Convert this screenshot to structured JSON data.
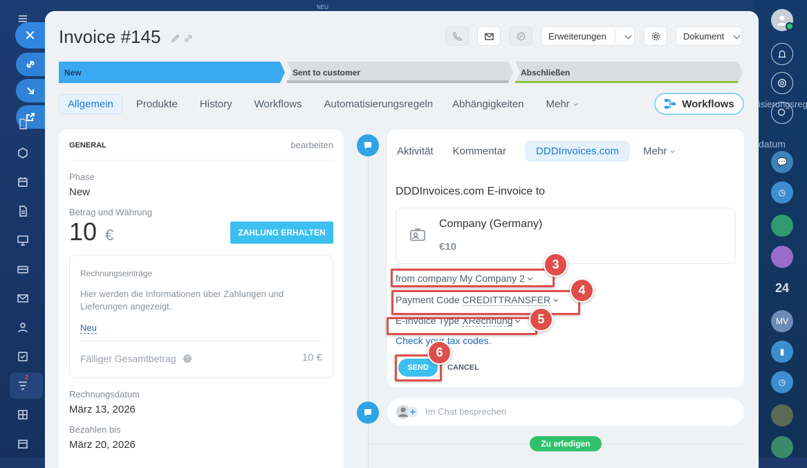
{
  "app": {
    "left_nav_icons": [
      "menu-icon",
      "chat-icon",
      "document-icon",
      "shield-icon",
      "calendar-icon",
      "file-icon",
      "presentation-icon",
      "card-icon",
      "mail-icon",
      "people-icon",
      "checklist-icon",
      "funnel-icon",
      "grid-icon",
      "archive-icon"
    ],
    "funnel_badge": "2",
    "top_badge": "NEU",
    "right_avatar_initials": "MV",
    "right_badge_24": "24",
    "right_partial_text": "isierungsrege",
    "right_partial_text_2": "datum"
  },
  "header": {
    "title": "Invoice #145",
    "erweiterungen_label": "Erweiterungen",
    "dokument_label": "Dokument"
  },
  "stages": [
    {
      "label": "New",
      "color": "#3ba9ef",
      "text_color": "#1b3f6b"
    },
    {
      "label": "Sent to customer",
      "color": "#d8dde1",
      "text_color": "#3a434c"
    },
    {
      "label": "Abschließen",
      "color": "#d8dde1",
      "text_color": "#3a434c"
    }
  ],
  "tabs": [
    "Allgemein",
    "Produkte",
    "History",
    "Workflows",
    "Automatisierungsregeln",
    "Abhängigkeiten",
    "Mehr"
  ],
  "workflows_button": "Workflows",
  "general": {
    "heading": "GENERAL",
    "edit": "bearbeiten",
    "phase_label": "Phase",
    "phase_value": "New",
    "amount_label": "Betrag und Währung",
    "amount_value": "10",
    "currency": "€",
    "payment_button": "ZAHLUNG ERHALTEN",
    "entries_title": "Rechnungseinträge",
    "entries_text": "Hier werden die Informationen über Zahlungen und Lieferungen angezeigt.",
    "new_link": "Neu",
    "total_label": "Fälliger Gesamtbetrag",
    "total_value": "10 €",
    "invoice_date_label": "Rechnungsdatum",
    "invoice_date": "März 13, 2026",
    "pay_until_label": "Bezahlen bis",
    "pay_until": "März 20, 2026"
  },
  "activity": {
    "tabs": [
      "Aktivität",
      "Kommentar",
      "DDDInvoices.com",
      "Mehr"
    ],
    "heading": "DDDInvoices.com E-invoice to",
    "company_name": "Company (Germany)",
    "company_amount": "€10",
    "from_company": "from company My Company 2",
    "payment_code_label": "Payment Code",
    "payment_code_value": "CREDITTRANSFER",
    "einvoice_label": "E-Invoice Type",
    "einvoice_value": "XRechnung",
    "tax_link": "Check your tax codes.",
    "send": "SEND",
    "cancel": "CANCEL",
    "chat_placeholder": "Im Chat besprechen",
    "todo_badge": "Zu erledigen"
  },
  "annotations": [
    "3",
    "4",
    "5",
    "6"
  ]
}
